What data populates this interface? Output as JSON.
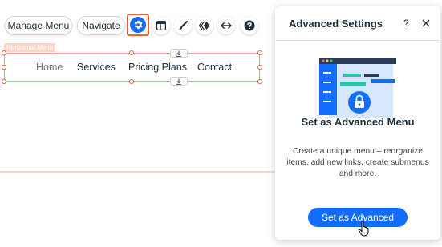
{
  "toolbar": {
    "manage_menu_label": "Manage Menu",
    "navigate_label": "Navigate",
    "icons": [
      "gear-icon",
      "layout-icon",
      "brush-icon",
      "animation-icon",
      "stretch-icon",
      "help-icon"
    ]
  },
  "menu": {
    "tag": "Horizontal Menu",
    "items": [
      "Home",
      "Services",
      "Pricing Plans",
      "Contact"
    ]
  },
  "panel": {
    "title": "Advanced Settings",
    "help": "?",
    "heading": "Set as Advanced Menu",
    "description": "Create a unique menu – reorganize items, add new links, create submenus and more.",
    "button_label": "Set as Advanced"
  },
  "colors": {
    "accent": "#116dff",
    "selection": "#e8623b",
    "selection_light": "#fbd6c9"
  }
}
